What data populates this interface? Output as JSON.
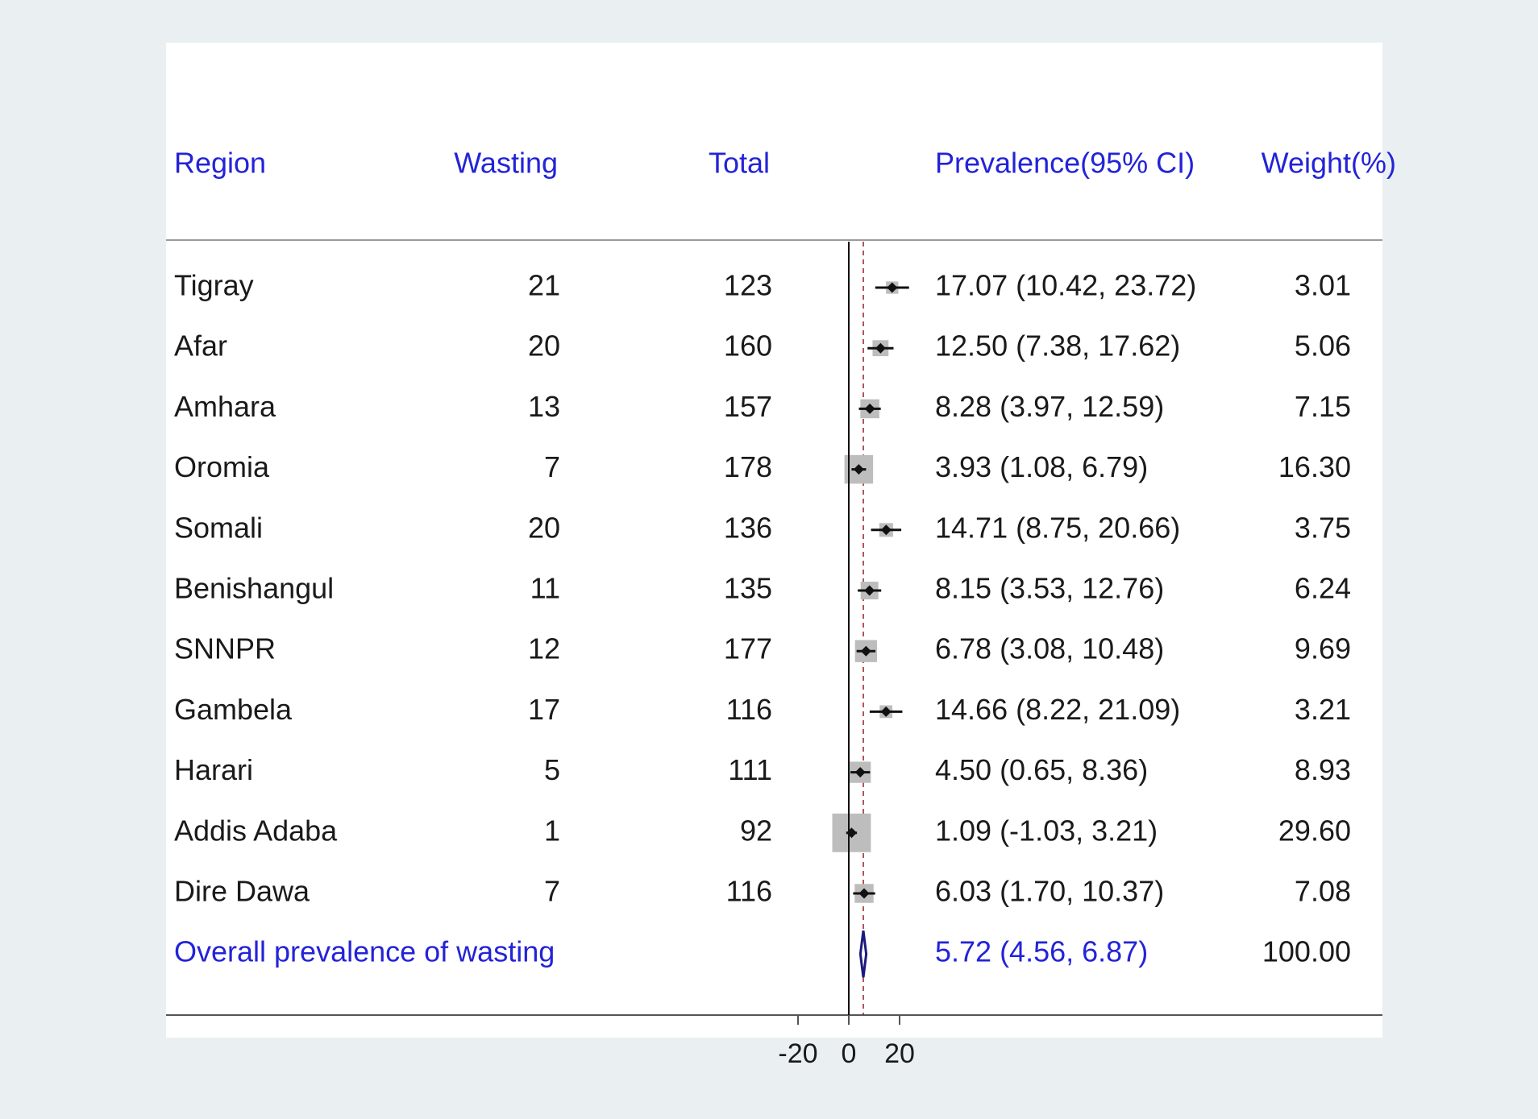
{
  "chart_data": {
    "type": "forest",
    "columns": [
      "Region",
      "Wasting",
      "Total",
      "Prevalence(95% CI)",
      "Weight(%)"
    ],
    "rows": [
      {
        "region": "Tigray",
        "wasting": "21",
        "total": "123",
        "ci_text": "17.07 (10.42, 23.72)",
        "weight_text": "3.01",
        "estimate": 17.07,
        "lower": 10.42,
        "upper": 23.72,
        "weight": 3.01
      },
      {
        "region": "Afar",
        "wasting": "20",
        "total": "160",
        "ci_text": "12.50 (7.38, 17.62)",
        "weight_text": "5.06",
        "estimate": 12.5,
        "lower": 7.38,
        "upper": 17.62,
        "weight": 5.06
      },
      {
        "region": "Amhara",
        "wasting": "13",
        "total": "157",
        "ci_text": "8.28 (3.97, 12.59)",
        "weight_text": "7.15",
        "estimate": 8.28,
        "lower": 3.97,
        "upper": 12.59,
        "weight": 7.15
      },
      {
        "region": "Oromia",
        "wasting": "7",
        "total": "178",
        "ci_text": "3.93 (1.08, 6.79)",
        "weight_text": "16.30",
        "estimate": 3.93,
        "lower": 1.08,
        "upper": 6.79,
        "weight": 16.3
      },
      {
        "region": "Somali",
        "wasting": "20",
        "total": "136",
        "ci_text": "14.71 (8.75, 20.66)",
        "weight_text": "3.75",
        "estimate": 14.71,
        "lower": 8.75,
        "upper": 20.66,
        "weight": 3.75
      },
      {
        "region": "Benishangul",
        "wasting": "11",
        "total": "135",
        "ci_text": "8.15 (3.53, 12.76)",
        "weight_text": "6.24",
        "estimate": 8.15,
        "lower": 3.53,
        "upper": 12.76,
        "weight": 6.24
      },
      {
        "region": "SNNPR",
        "wasting": "12",
        "total": "177",
        "ci_text": "6.78 (3.08, 10.48)",
        "weight_text": "9.69",
        "estimate": 6.78,
        "lower": 3.08,
        "upper": 10.48,
        "weight": 9.69
      },
      {
        "region": "Gambela",
        "wasting": "17",
        "total": "116",
        "ci_text": "14.66 (8.22, 21.09)",
        "weight_text": "3.21",
        "estimate": 14.66,
        "lower": 8.22,
        "upper": 21.09,
        "weight": 3.21
      },
      {
        "region": "Harari",
        "wasting": "5",
        "total": "111",
        "ci_text": "4.50 (0.65, 8.36)",
        "weight_text": "8.93",
        "estimate": 4.5,
        "lower": 0.65,
        "upper": 8.36,
        "weight": 8.93
      },
      {
        "region": "Addis Adaba",
        "wasting": "1",
        "total": "92",
        "ci_text": "1.09 (-1.03, 3.21)",
        "weight_text": "29.60",
        "estimate": 1.09,
        "lower": -1.03,
        "upper": 3.21,
        "weight": 29.6
      },
      {
        "region": "Dire Dawa",
        "wasting": "7",
        "total": "116",
        "ci_text": "6.03 (1.70, 10.37)",
        "weight_text": "7.08",
        "estimate": 6.03,
        "lower": 1.7,
        "upper": 10.37,
        "weight": 7.08
      }
    ],
    "overall": {
      "label": "Overall prevalence of wasting",
      "ci_text": "5.72 (4.56, 6.87)",
      "weight_text": "100.00",
      "estimate": 5.72,
      "lower": 4.56,
      "upper": 6.87
    },
    "x_ticks": [
      -20,
      0,
      20
    ],
    "reference_line": 0,
    "overall_line": 5.72,
    "colors": {
      "header": "#2323d8",
      "text": "#1a1a1a",
      "box": "#bdbdbd",
      "diamond": "#1a1a80",
      "overall_line": "#9b2020"
    }
  }
}
